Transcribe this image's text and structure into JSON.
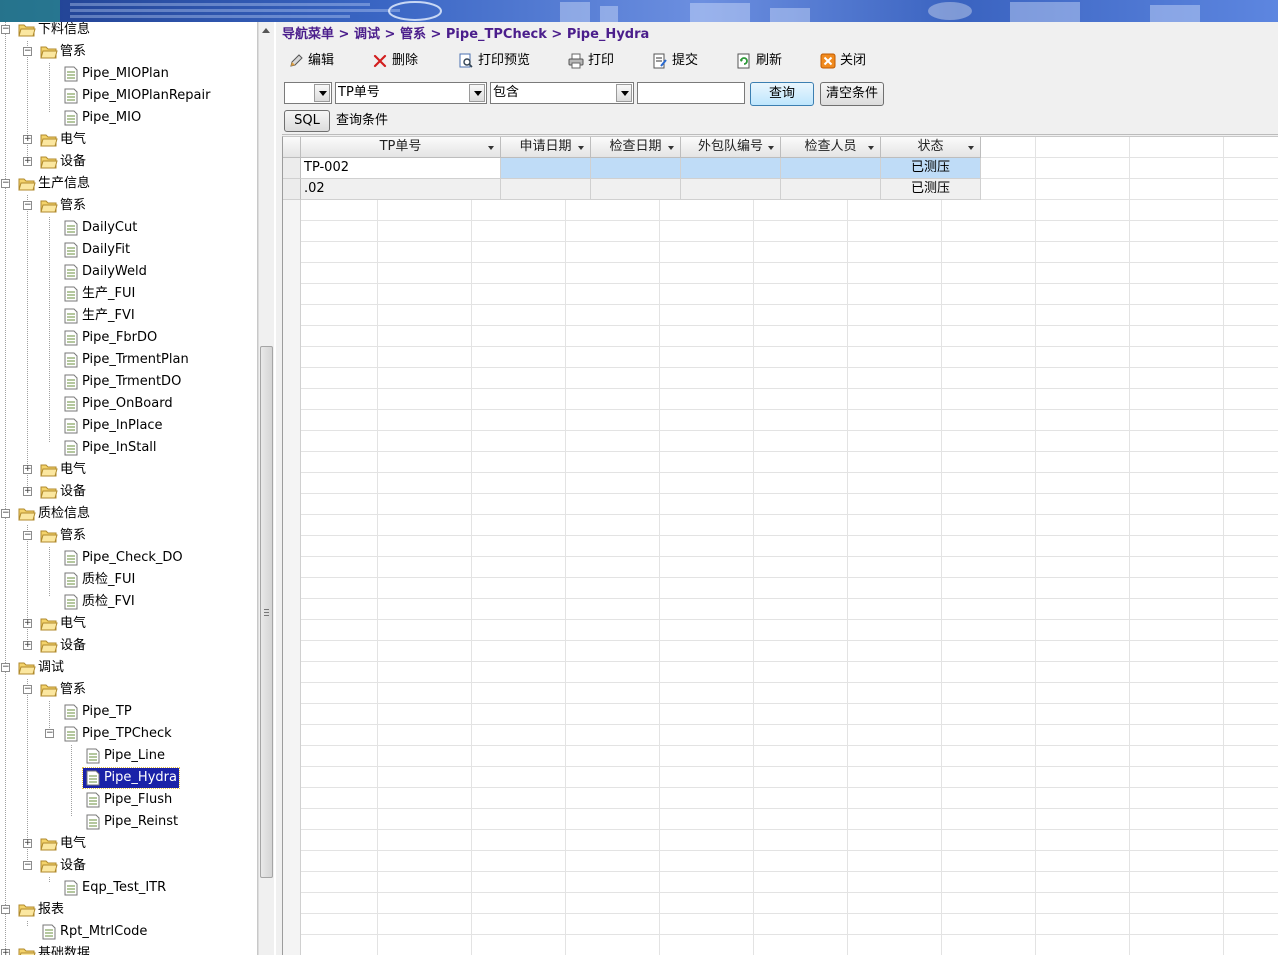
{
  "breadcrumb": {
    "items": [
      "导航菜单",
      "调试",
      "管系",
      "Pipe_TPCheck",
      "Pipe_Hydra"
    ],
    "separator": " > "
  },
  "toolbar": {
    "edit": "编辑",
    "delete": "删除",
    "print_preview": "打印预览",
    "print": "打印",
    "submit": "提交",
    "refresh": "刷新",
    "close": "关闭"
  },
  "filter": {
    "combo1_value": "",
    "field_value": "TP单号",
    "operator_value": "包含",
    "text_value": "",
    "query_button": "查询",
    "clear_button": "清空条件"
  },
  "sql": {
    "button": "SQL",
    "condition_label": "查询条件"
  },
  "tree": {
    "items": [
      {
        "label": "下料信息"
      },
      {
        "label": "管系"
      },
      {
        "label": "Pipe_MIOPlan"
      },
      {
        "label": "Pipe_MIOPlanRepair"
      },
      {
        "label": "Pipe_MIO"
      },
      {
        "label": "电气"
      },
      {
        "label": "设备"
      },
      {
        "label": "生产信息"
      },
      {
        "label": "管系"
      },
      {
        "label": "DailyCut"
      },
      {
        "label": "DailyFit"
      },
      {
        "label": "DailyWeld"
      },
      {
        "label": "生产_FUI"
      },
      {
        "label": "生产_FVI"
      },
      {
        "label": "Pipe_FbrDO"
      },
      {
        "label": "Pipe_TrmentPlan"
      },
      {
        "label": "Pipe_TrmentDO"
      },
      {
        "label": "Pipe_OnBoard"
      },
      {
        "label": "Pipe_InPlace"
      },
      {
        "label": "Pipe_InStall"
      },
      {
        "label": "电气"
      },
      {
        "label": "设备"
      },
      {
        "label": "质检信息"
      },
      {
        "label": "管系"
      },
      {
        "label": "Pipe_Check_DO"
      },
      {
        "label": "质检_FUI"
      },
      {
        "label": "质检_FVI"
      },
      {
        "label": "电气"
      },
      {
        "label": "设备"
      },
      {
        "label": "调试"
      },
      {
        "label": "管系"
      },
      {
        "label": "Pipe_TP"
      },
      {
        "label": "Pipe_TPCheck"
      },
      {
        "label": "Pipe_Line"
      },
      {
        "label": "Pipe_Hydra"
      },
      {
        "label": "Pipe_Flush"
      },
      {
        "label": "Pipe_Reinst"
      },
      {
        "label": "电气"
      },
      {
        "label": "设备"
      },
      {
        "label": "Eqp_Test_ITR"
      },
      {
        "label": "报表"
      },
      {
        "label": "Rpt_MtrlCode"
      },
      {
        "label": "基础数据"
      }
    ]
  },
  "grid": {
    "columns": [
      "TP单号",
      "申请日期",
      "检查日期",
      "外包队编号",
      "检查人员",
      "状态"
    ],
    "rows": [
      [
        "TP-002",
        "",
        "",
        "",
        "",
        "已测压"
      ],
      [
        ".02",
        "",
        "",
        "",
        "",
        "已测压"
      ]
    ]
  },
  "colors": {
    "breadcrumb": "#4b1e8c",
    "selection": "#1a22a8",
    "row_selected": "#bfdcf7",
    "banner": "#3a66c4"
  },
  "icons": {
    "edit": "edit-icon",
    "delete": "delete-x-icon",
    "print_preview": "print-preview-icon",
    "print": "printer-icon",
    "submit": "submit-doc-icon",
    "refresh": "refresh-icon",
    "close": "close-icon"
  }
}
